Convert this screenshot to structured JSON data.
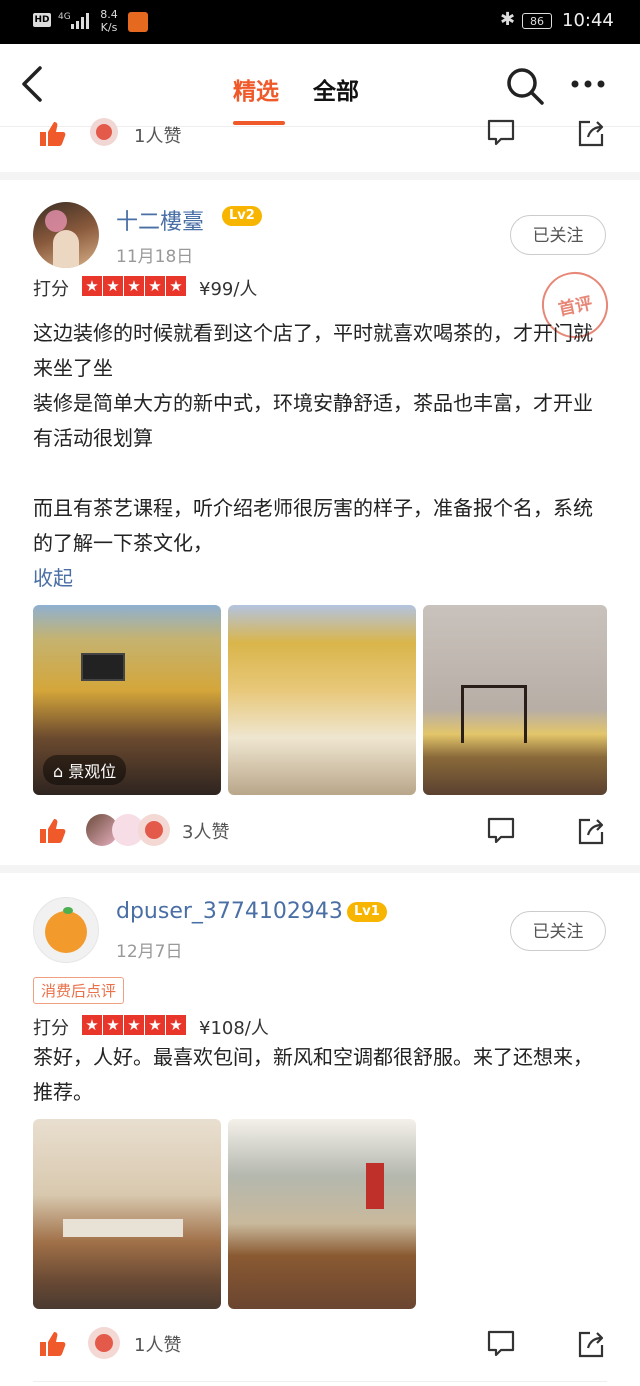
{
  "status_bar": {
    "network": "4G",
    "speed_value": "8.4",
    "speed_unit": "K/s",
    "battery": "86",
    "time": "10:44"
  },
  "nav": {
    "tab_featured": "精选",
    "tab_all": "全部"
  },
  "top_partial": {
    "likes": "1人赞"
  },
  "reviews": [
    {
      "user": "十二樓臺",
      "level": "Lv2",
      "date": "11月18日",
      "follow_label": "已关注",
      "rating_label": "打分",
      "stars": 5,
      "price": "¥99/人",
      "stamp_text": "首评",
      "text": "这边装修的时候就看到这个店了，平时就喜欢喝茶的，才开门就来坐了坐\n装修是简单大方的新中式，环境安静舒适，茶品也丰富，才开业有活动很划算\n\n而且有茶艺课程，听介绍老师很厉害的样子，准备报个名，系统的了解一下茶文化，",
      "collapse_label": "收起",
      "photo_tag": "景观位",
      "likes": "3人赞"
    },
    {
      "user": "dpuser_3774102943",
      "level": "Lv1",
      "date": "12月7日",
      "follow_label": "已关注",
      "consume_tag": "消费后点评",
      "rating_label": "打分",
      "stars": 5,
      "price": "¥108/人",
      "text": "茶好，人好。最喜欢包间，新风和空调都很舒服。来了还想来，推荐。",
      "likes": "1人赞"
    }
  ],
  "colors": {
    "accent": "#f0592a",
    "link": "#4a6fa5",
    "star_bg": "#e8362a",
    "badge": "#f7b500"
  }
}
